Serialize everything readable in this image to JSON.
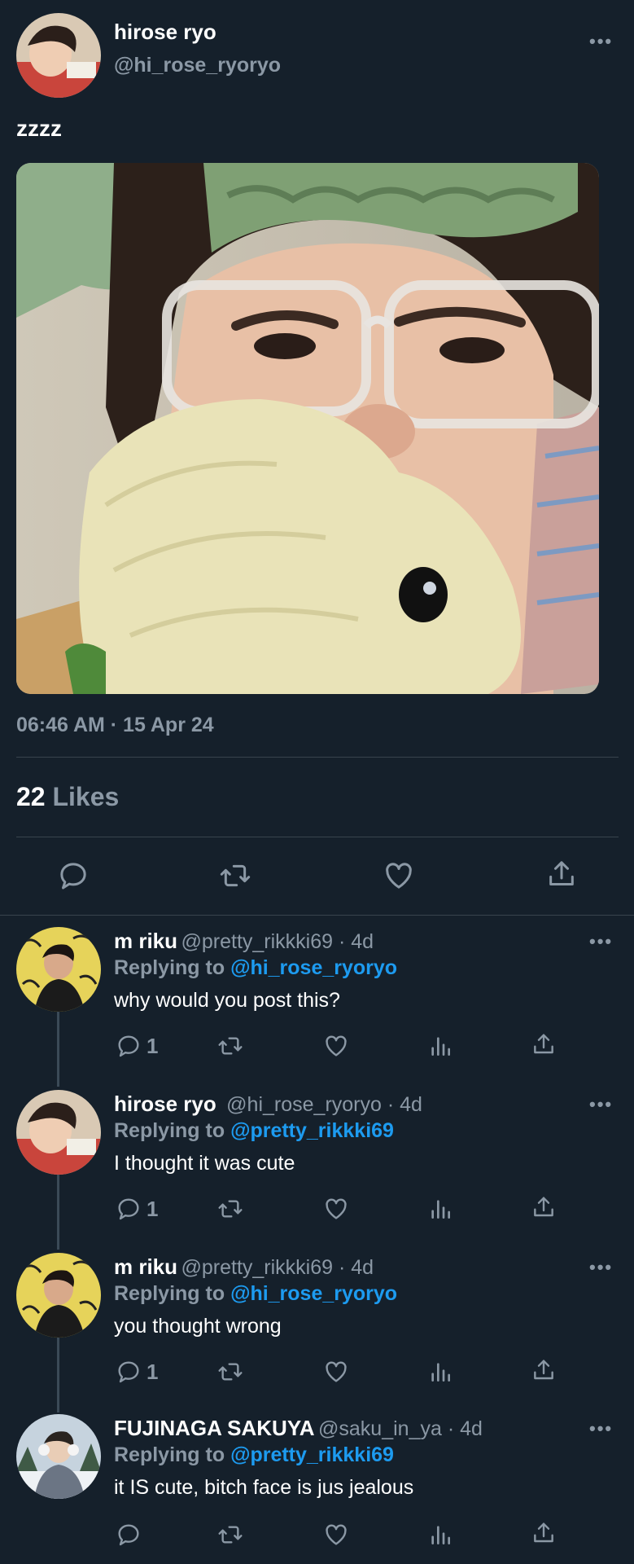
{
  "main_tweet": {
    "display_name": "hirose ryo",
    "handle": "@hi_rose_ryoryo",
    "text": "zzzz",
    "timestamp": "06:46 AM · 15 Apr 24",
    "likes_count": "22",
    "likes_label": "Likes",
    "more_label": "•••"
  },
  "replies": [
    {
      "display_name": "m riku",
      "meta": "@pretty_rikkki69 · 4d",
      "replying_to_label": "Replying to",
      "replying_to_handle": "@hi_rose_ryoryo",
      "text": "why would you post this?",
      "reply_count": "1",
      "more_label": "•••"
    },
    {
      "display_name": "hirose ryo",
      "meta": "@hi_rose_ryoryo · 4d",
      "replying_to_label": "Replying to",
      "replying_to_handle": "@pretty_rikkki69",
      "text": "I thought it was cute",
      "reply_count": "1",
      "more_label": "•••"
    },
    {
      "display_name": "m riku",
      "meta": "@pretty_rikkki69 · 4d",
      "replying_to_label": "Replying to",
      "replying_to_handle": "@hi_rose_ryoryo",
      "text": "you thought wrong",
      "reply_count": "1",
      "more_label": "•••"
    },
    {
      "display_name": "FUJINAGA SAKUYA",
      "meta": "@saku_in_ya · 4d",
      "replying_to_label": "Replying to",
      "replying_to_handle": "@pretty_rikkki69",
      "text": "it IS cute, bitch face is jus jealous",
      "reply_count": "",
      "more_label": "•••"
    }
  ],
  "colors": {
    "background": "#15202b",
    "secondary_text": "#8b98a5",
    "mention": "#1d9bf0",
    "divider": "#38444d"
  },
  "icons": [
    "more-icon",
    "reply-icon",
    "retweet-icon",
    "like-icon",
    "views-icon",
    "share-icon"
  ]
}
